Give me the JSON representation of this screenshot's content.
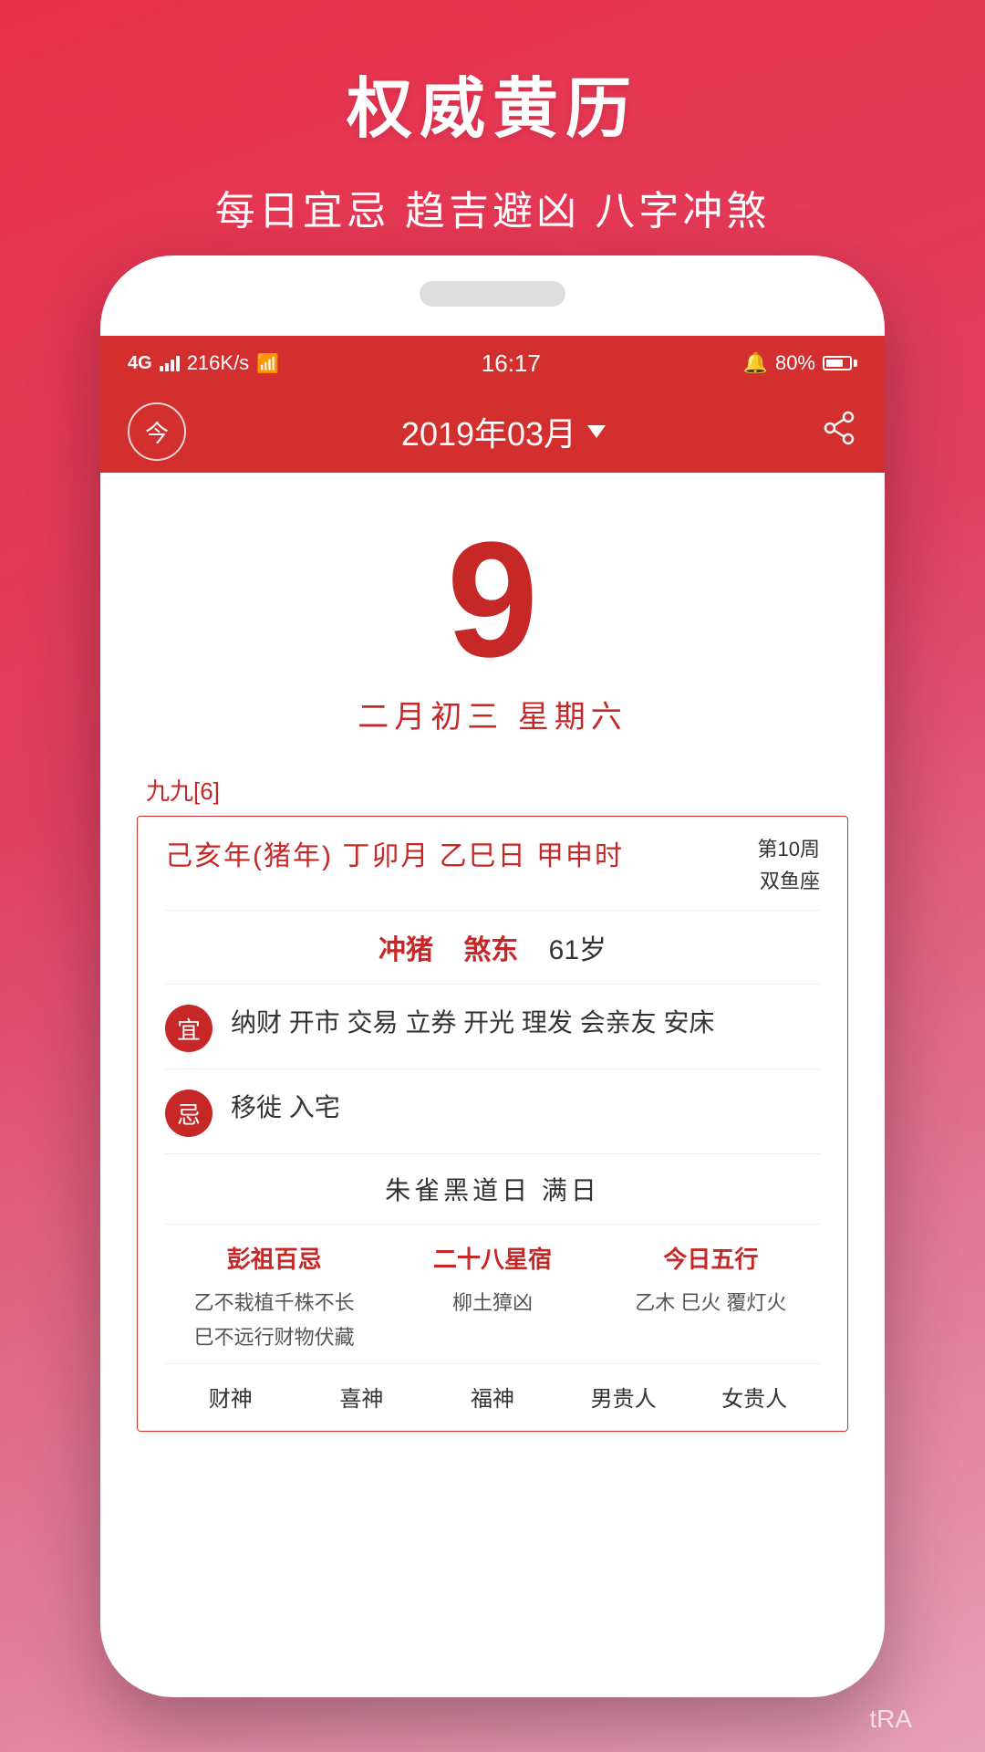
{
  "promo": {
    "title": "权威黄历",
    "subtitle": "每日宜忌 趋吉避凶 八字冲煞"
  },
  "status_bar": {
    "network": "4G",
    "speed": "216K/s",
    "wifi": "WiFi",
    "time": "16:17",
    "alarm": "🔔",
    "battery_pct": "80%"
  },
  "header": {
    "today_label": "今",
    "month_selector": "2019年03月",
    "dropdown_arrow": "▼"
  },
  "calendar": {
    "day_number": "9",
    "lunar_date": "二月初三  星期六"
  },
  "nine_nine": "九九[6]",
  "ganzhi": {
    "main": "己亥年(猪年) 丁卯月 乙巳日 甲申时",
    "week": "第10周",
    "zodiac": "双鱼座"
  },
  "chong": {
    "label1": "冲猪",
    "label2": "煞东",
    "age": "61岁"
  },
  "yi": {
    "badge": "宜",
    "text": "纳财 开市 交易 立券 开光 理发 会亲友 安床"
  },
  "ji": {
    "badge": "忌",
    "text": "移徙 入宅"
  },
  "black_day": "朱雀黑道日  满日",
  "bottom_cols": [
    {
      "title": "彭祖百忌",
      "lines": [
        "乙不栽植千株不长",
        "巳不远行财物伏藏"
      ]
    },
    {
      "title": "二十八星宿",
      "lines": [
        "柳土獐凶"
      ]
    },
    {
      "title": "今日五行",
      "lines": [
        "乙木 巳火 覆灯火"
      ]
    }
  ],
  "shen_items": [
    "财神",
    "喜神",
    "福神",
    "男贵人",
    "女贵人"
  ]
}
